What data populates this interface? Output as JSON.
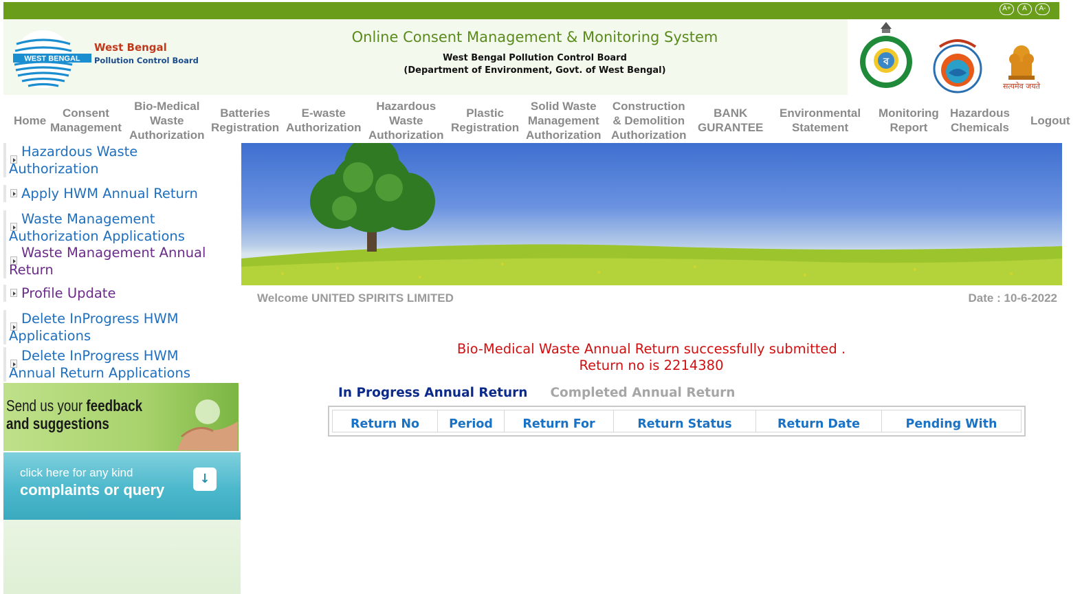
{
  "font_controls": [
    "A+",
    "A",
    "A-"
  ],
  "header": {
    "org_name_line1": "West Bengal",
    "org_name_line2": "Pollution Control Board",
    "logo_text": "WEST BENGAL",
    "title": "Online Consent Management & Monitoring System",
    "subtitle1": "West Bengal Pollution Control Board",
    "subtitle2": "(Department of Environment, Govt. of West Bengal)",
    "emblem_motto": "सत्यमेव जयते"
  },
  "nav": {
    "home": "Home",
    "consent1": "Consent",
    "consent2": "Management",
    "bmw1": "Bio-Medical",
    "bmw2": "Waste",
    "bmw3": "Authorization",
    "bat1": "Batteries",
    "bat2": "Registration",
    "ew1": "E-waste",
    "ew2": "Authorization",
    "hw1": "Hazardous",
    "hw2": "Waste",
    "hw3": "Authorization",
    "pl1": "Plastic",
    "pl2": "Registration",
    "sw1": "Solid Waste",
    "sw2": "Management",
    "sw3": "Authorization",
    "cd1": "Construction",
    "cd2": "& Demolition",
    "cd3": "Authorization",
    "bank1": "BANK",
    "bank2": "GURANTEE",
    "env1": "Environmental",
    "env2": "Statement",
    "mon1": "Monitoring",
    "mon2": "Report",
    "hc1": "Hazardous",
    "hc2": "Chemicals",
    "logout": "Logout"
  },
  "sidebar": {
    "items": [
      {
        "line1": "Hazardous Waste",
        "line2": "Authorization"
      },
      {
        "line1": "Apply HWM Annual Return",
        "line2": ""
      },
      {
        "line1": "Waste Management",
        "line2": "Authorization Applications"
      },
      {
        "line1": "Waste Management Annual",
        "line2": "Return"
      },
      {
        "line1": "Profile Update",
        "line2": ""
      },
      {
        "line1": "Delete InProgress HWM",
        "line2": "Applications"
      },
      {
        "line1": "Delete InProgress HWM",
        "line2": "Annual Return Applications"
      }
    ],
    "feedback_line1_pre": "Send us your ",
    "feedback_line1_bold": "feedback",
    "feedback_line2": "and suggestions",
    "complaint_line1": "click here for any kind",
    "complaint_line2": "complaints or query"
  },
  "main": {
    "welcome": "Welcome UNITED SPIRITS LIMITED",
    "date": "Date : 10-6-2022",
    "message_line1": "Bio-Medical Waste Annual Return successfully submitted .",
    "message_line2": "Return no is 2214380",
    "tabs": [
      "In Progress Annual Return",
      "Completed Annual Return"
    ],
    "table_headers": [
      "Return No",
      "Period",
      "Return For",
      "Return Status",
      "Return Date",
      "Pending With"
    ]
  },
  "colors": {
    "top_bar": "#6a9e1a",
    "title_green": "#5a8a1c",
    "link_blue": "#1f6fbf",
    "success_red": "#d01010",
    "active_tab": "#0b2a8a"
  }
}
